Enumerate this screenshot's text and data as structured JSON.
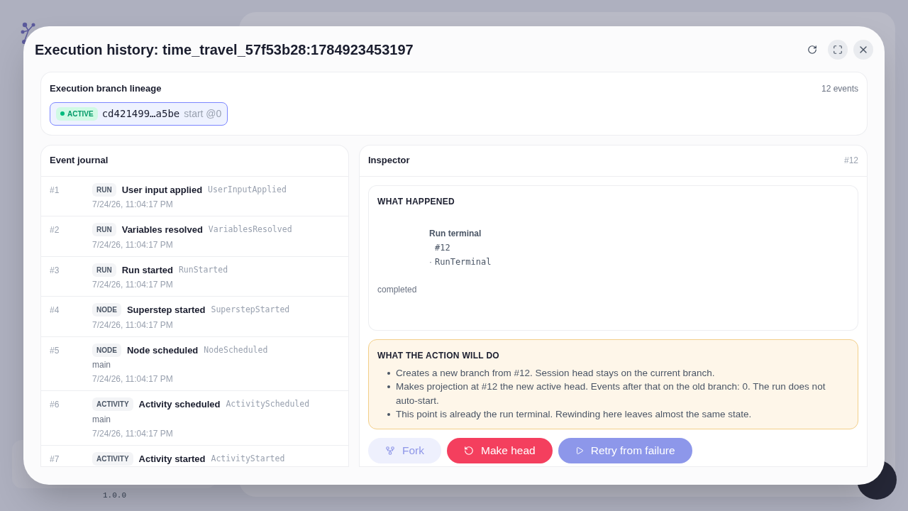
{
  "modal": {
    "title": "Execution history: time_travel_57f53b28:1784923453197"
  },
  "lineage": {
    "title": "Execution branch lineage",
    "count": "12 events",
    "branches": [
      {
        "status": "ACTIVE",
        "hash": "cd421499…a5be",
        "start": "start @0",
        "selected": true
      }
    ]
  },
  "journal": {
    "title": "Event journal",
    "events": [
      {
        "number": "#1",
        "category": "RUN",
        "title": "User input applied",
        "type": "UserInputApplied",
        "time": "7/24/26, 11:04:17 PM"
      },
      {
        "number": "#2",
        "category": "RUN",
        "title": "Variables resolved",
        "type": "VariablesResolved",
        "time": "7/24/26, 11:04:17 PM"
      },
      {
        "number": "#3",
        "category": "RUN",
        "title": "Run started",
        "type": "RunStarted",
        "time": "7/24/26, 11:04:17 PM"
      },
      {
        "number": "#4",
        "category": "NODE",
        "title": "Superstep started",
        "type": "SuperstepStarted",
        "time": "7/24/26, 11:04:17 PM"
      },
      {
        "number": "#5",
        "category": "NODE",
        "title": "Node scheduled",
        "type": "NodeScheduled",
        "detail": "main",
        "time": "7/24/26, 11:04:17 PM"
      },
      {
        "number": "#6",
        "category": "ACTIVITY",
        "title": "Activity scheduled",
        "type": "ActivityScheduled",
        "detail": "main",
        "time": "7/24/26, 11:04:17 PM"
      },
      {
        "number": "#7",
        "category": "ACTIVITY",
        "title": "Activity started",
        "type": "ActivityStarted"
      }
    ]
  },
  "inspector": {
    "title": "Inspector",
    "event_ref": "#12",
    "what_happened": {
      "heading": "WHAT HAPPENED",
      "title": "Run terminal",
      "number": "#12",
      "separator": "·",
      "type": "RunTerminal",
      "status": "completed"
    },
    "action_preview": {
      "heading": "WHAT THE ACTION WILL DO",
      "items": [
        "Creates a new branch from #12. Session head stays on the current branch.",
        "Makes projection at #12 the new active head. Events after that on the old branch: 0. The run does not auto-start.",
        "This point is already the run terminal. Rewinding here leaves almost the same state."
      ]
    },
    "buttons": [
      {
        "label": "Fork",
        "kind": "fork",
        "disabled": true
      },
      {
        "label": "Make head",
        "kind": "make-head",
        "disabled": false
      },
      {
        "label": "Retry from failure",
        "kind": "retry",
        "disabled": true
      }
    ]
  },
  "version": "1.0.0"
}
